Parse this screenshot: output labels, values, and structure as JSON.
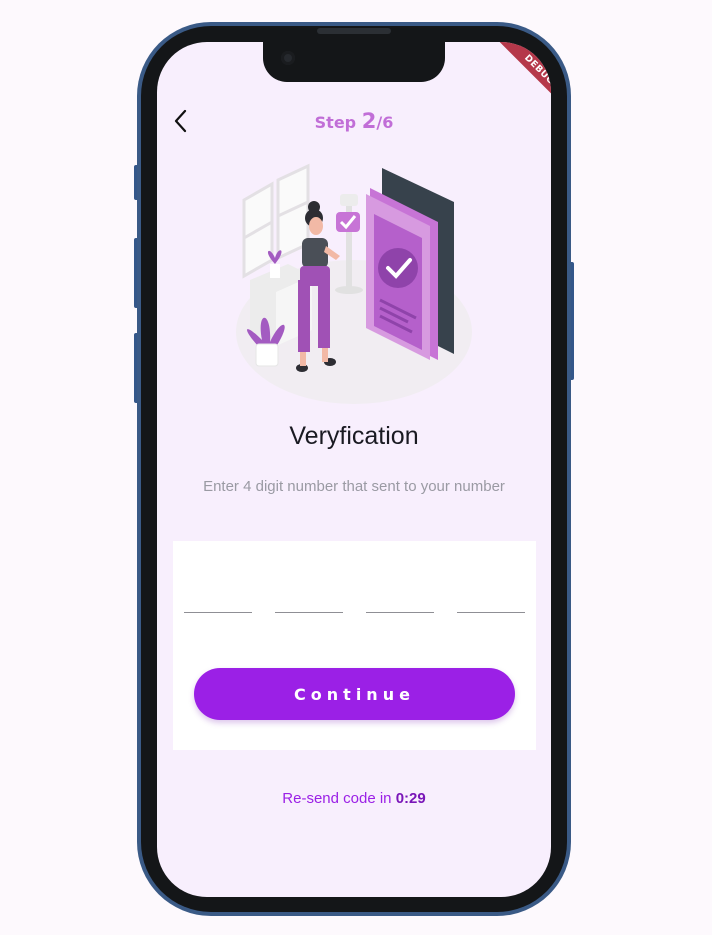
{
  "header": {
    "step_prefix": "Step",
    "step_current": "2",
    "step_total": "/6",
    "debug_banner": "DEBUG"
  },
  "main": {
    "title": "Veryfication",
    "subtitle": "Enter 4 digit number that sent to your number",
    "otp_fields": [
      "",
      "",
      "",
      ""
    ],
    "continue_label": "Continue",
    "resend_prefix": "Re-send code in",
    "resend_timer": "0:29"
  },
  "icons": {
    "back": "chevron-left-icon",
    "illustration": "verification-illustration"
  },
  "colors": {
    "accent": "#9b20e6",
    "step_text": "#c16ed7",
    "screen_bg": "#f8effd",
    "frame": "#3a5a86",
    "debug_banner": "#b5384a"
  }
}
